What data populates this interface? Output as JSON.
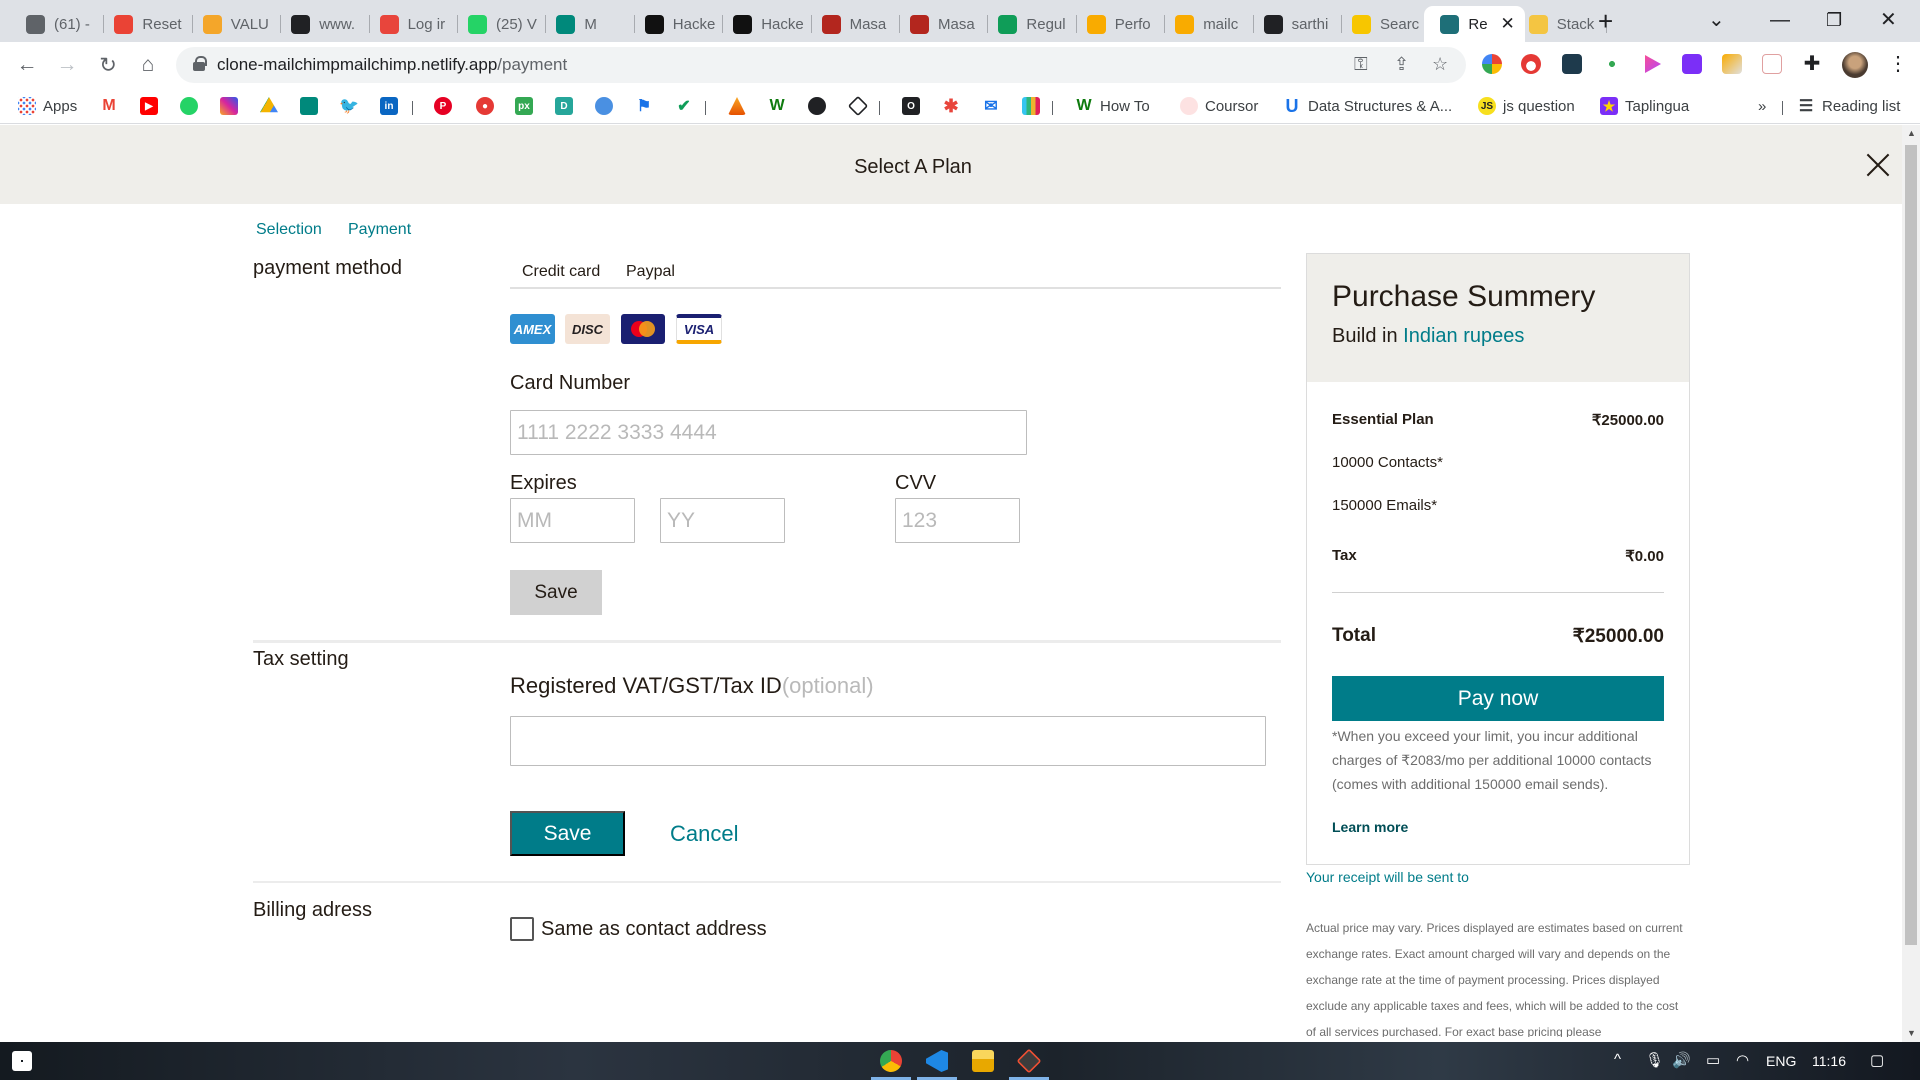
{
  "browser": {
    "tabs": [
      {
        "title": "(61) -",
        "icon": "mailchimp-icon",
        "color": "#5f6368"
      },
      {
        "title": "Reset",
        "icon": "gmail-icon",
        "color": "#ea4335"
      },
      {
        "title": "VALU",
        "icon": "vs-icon",
        "color": "#f4a62a"
      },
      {
        "title": "www.",
        "icon": "globe-icon",
        "color": "#202124"
      },
      {
        "title": "Log ir",
        "icon": "asterisk-icon",
        "color": "#e8453c"
      },
      {
        "title": "(25) V",
        "icon": "whatsapp-icon",
        "color": "#25d366"
      },
      {
        "title": "M",
        "icon": "meet-icon",
        "color": "#00897b"
      },
      {
        "title": "Hacke",
        "icon": "hackerrank-icon",
        "color": "#111111"
      },
      {
        "title": "Hacke",
        "icon": "hackerrank-icon",
        "color": "#111111"
      },
      {
        "title": "Masa",
        "icon": "masai-icon",
        "color": "#b3261e"
      },
      {
        "title": "Masa",
        "icon": "masai-icon",
        "color": "#b3261e"
      },
      {
        "title": "Regul",
        "icon": "plus-icon",
        "color": "#0f9d58"
      },
      {
        "title": "Perfo",
        "icon": "lightning-icon",
        "color": "#f9ab00"
      },
      {
        "title": "mailc",
        "icon": "lightning-icon",
        "color": "#f9ab00"
      },
      {
        "title": "sarthi",
        "icon": "github-icon",
        "color": "#202124"
      },
      {
        "title": "Searc",
        "icon": "search-app-icon",
        "color": "#f7c600"
      },
      {
        "title": "Re",
        "icon": "react-icon",
        "color": "#1e6f78"
      },
      {
        "title": "Stack",
        "icon": "stack-icon",
        "color": "#f4c542"
      }
    ],
    "address": {
      "host": "clone-mailchimpmailchimp.netlify.app",
      "path": "/payment"
    },
    "bookmarks": {
      "apps_label": "Apps",
      "howto_label": "How To",
      "coursor_label": "Coursor",
      "dsa_label": "Data Structures & A...",
      "js_label": "js question",
      "taplingua_label": "Taplingua",
      "more_label": "»",
      "reading_label": "Reading list"
    }
  },
  "page": {
    "title": "Select A Plan",
    "breadcrumbs": [
      "Selection",
      "Payment"
    ],
    "payment": {
      "section_label": "payment method",
      "tabs": [
        "Credit card",
        "Paypal"
      ],
      "cards": [
        "AMEX",
        "DISC",
        "",
        "VISA"
      ],
      "card_number_label": "Card Number",
      "card_number_placeholder": "1111 2222 3333 4444",
      "expires_label": "Expires",
      "month_placeholder": "MM",
      "year_placeholder": "YY",
      "cvv_label": "CVV",
      "cvv_placeholder": "123",
      "save_label": "Save"
    },
    "tax": {
      "section_label": "Tax setting",
      "field_label": "Registered VAT/GST/Tax ID",
      "optional_label": "(optional)",
      "value": "",
      "save_label": "Save",
      "cancel_label": "Cancel"
    },
    "billing": {
      "section_label": "Billing adress",
      "same_as_contact_label": "Same as contact address",
      "checked": false
    }
  },
  "summary": {
    "title": "Purchase Summery",
    "subtitle_prefix": "Build in ",
    "currency": "Indian rupees",
    "plan_name": "Essential Plan",
    "plan_price": "₹25000.00",
    "contacts": "10000 Contacts*",
    "emails": "150000 Emails*",
    "tax_label": "Tax",
    "tax_value": "₹0.00",
    "total_label": "Total",
    "total_value": "₹25000.00",
    "pay_label": "Pay now",
    "note": "*When you exceed your limit, you incur additional charges of ₹2083/mo per additional 10000 contacts (comes with additional 150000 email sends).",
    "learn_more": "Learn more",
    "receipt": "Your receipt will be sent to",
    "disclaimer": "Actual price may vary. Prices displayed are estimates based on current exchange rates. Exact amount charged will vary and depends on the exchange rate at the time of payment processing. Prices displayed exclude any applicable taxes and fees, which will be added to the cost of all services purchased. For exact base pricing please"
  },
  "taskbar": {
    "language": "ENG",
    "time": "11:16"
  },
  "colors": {
    "accent": "#007c89",
    "header_bg": "#efeeea",
    "text": "#241c15"
  }
}
